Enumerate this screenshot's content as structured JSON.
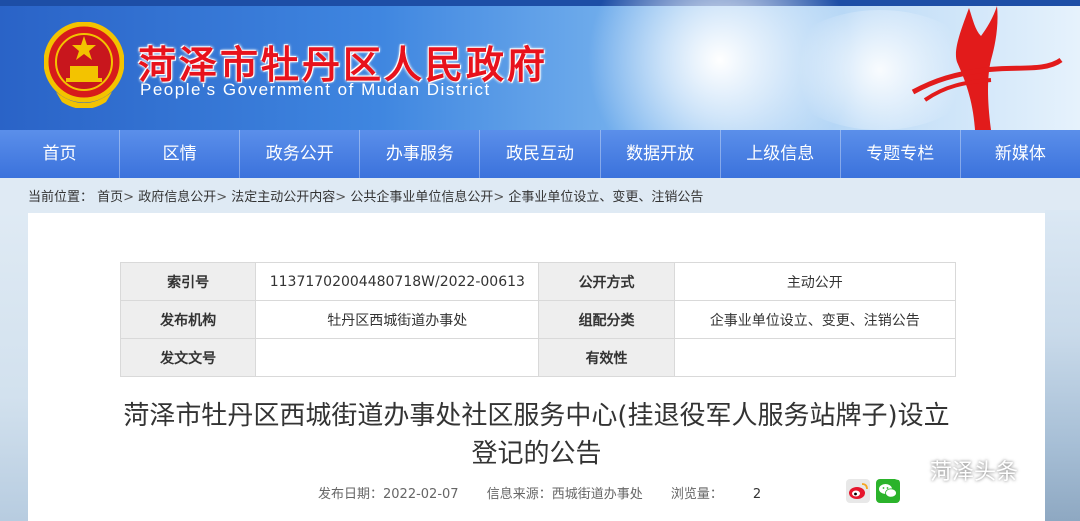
{
  "header": {
    "title": "菏泽市牡丹区人民政府",
    "subtitle": "People's Government of Mudan District",
    "emblem_icon": "national-emblem-icon",
    "sculpture_icon": "red-sculpture-icon",
    "title_color": "#e8121c"
  },
  "nav": {
    "items": [
      "首页",
      "区情",
      "政务公开",
      "办事服务",
      "政民互动",
      "数据开放",
      "上级信息",
      "专题专栏",
      "新媒体"
    ],
    "color": "#3b72dc"
  },
  "breadcrumb": {
    "label": "当前位置：",
    "items": [
      "首页",
      "政府信息公开",
      "法定主动公开内容",
      "公共企事业单位信息公开",
      "企事业单位设立、变更、注销公告"
    ],
    "separator": ">"
  },
  "meta": {
    "index_no_label": "索引号",
    "index_no": "11371702004480718W/2022-00613",
    "disclosure_label": "公开方式",
    "disclosure": "主动公开",
    "publisher_label": "发布机构",
    "publisher": "牡丹区西城街道办事处",
    "category_label": "组配分类",
    "category": "企事业单位设立、变更、注销公告",
    "doc_no_label": "发文文号",
    "doc_no": "",
    "validity_label": "有效性",
    "validity": ""
  },
  "article": {
    "title_line1": "菏泽市牡丹区西城街道办事处社区服务中心(挂退役军人服务站牌子)设立",
    "title_line2": "登记的公告",
    "date": "发布日期：2022-02-07",
    "source": "信息来源：西城街道办事处",
    "views_label": "浏览量：",
    "views": "2"
  },
  "share": {
    "weibo_icon": "weibo-icon",
    "wechat_icon": "wechat-icon"
  },
  "watermark": {
    "text": "菏泽头条",
    "icon": "wechat-outline-icon"
  }
}
